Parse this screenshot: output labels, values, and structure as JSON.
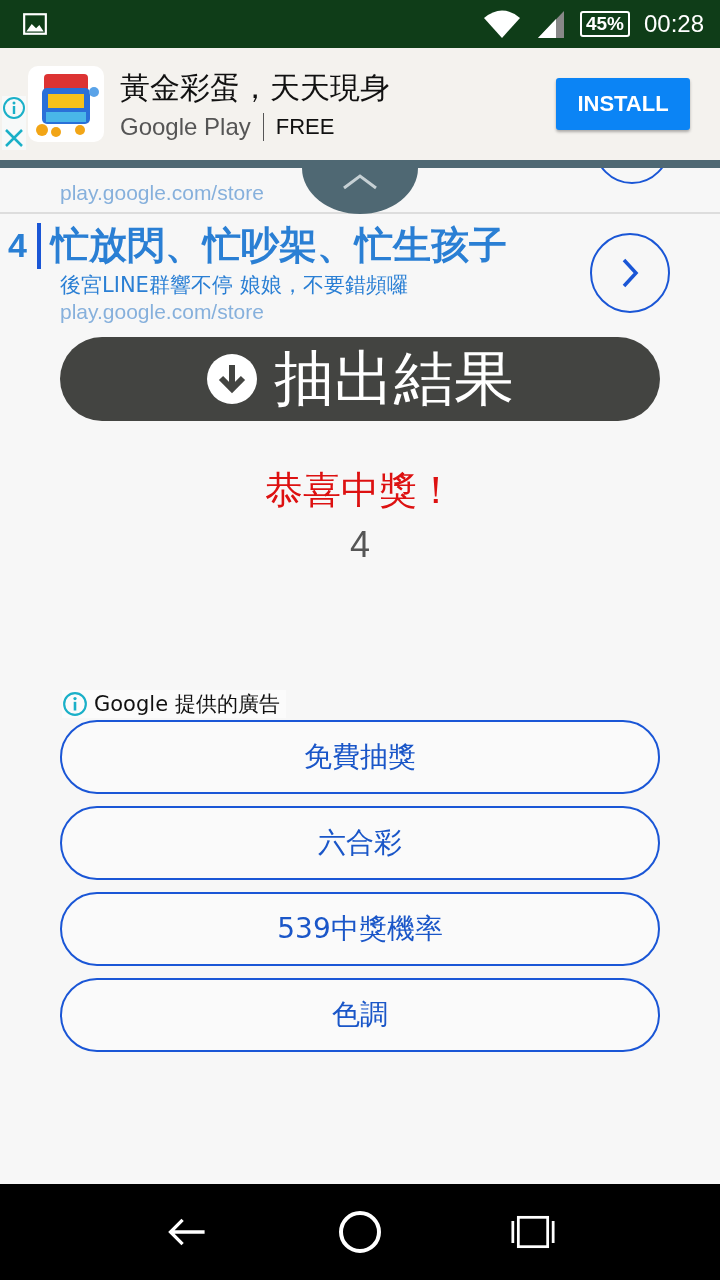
{
  "status_bar": {
    "battery": "45%",
    "time": "00:28"
  },
  "banner_ad": {
    "title": "黃金彩蛋，天天現身",
    "store": "Google Play",
    "price": "FREE",
    "install": "INSTALL"
  },
  "ad_results": [
    {
      "kind": "partial",
      "url": "play.google.com/store"
    },
    {
      "kind": "full",
      "number": "4",
      "title": "忙放閃、忙吵架、忙生孩子",
      "description": "後宮LINE群響不停 娘娘，不要錯頻囉",
      "url": "play.google.com/store"
    }
  ],
  "draw_button": {
    "label": "抽出結果"
  },
  "result": {
    "message": "恭喜中獎！",
    "number": "4"
  },
  "ad_label": "Google 提供的廣告",
  "links": [
    "免費抽獎",
    "六合彩",
    "539中獎機率",
    "色調"
  ]
}
